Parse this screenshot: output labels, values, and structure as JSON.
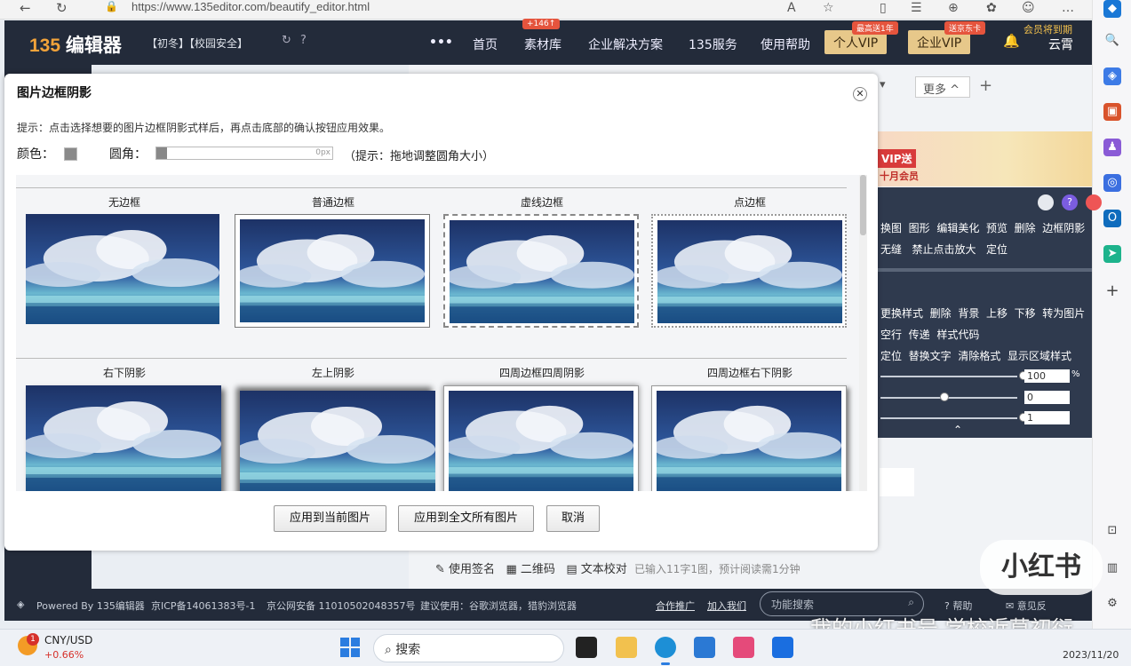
{
  "browser": {
    "url": "https://www.135editor.com/beautify_editor.html"
  },
  "header": {
    "logo_num": "135",
    "logo_text": "编辑器",
    "tags": "【初冬】【校园安全】",
    "nav": [
      "首页",
      "素材库",
      "企业解决方案",
      "135服务",
      "使用帮助"
    ],
    "nav_badge": "+146↑",
    "vip_personal": "个人VIP",
    "vip_personal_badge": "最高送1年",
    "vip_enterprise": "企业VIP",
    "vip_enterprise_badge": "送京东卡",
    "member_note": "会员将到期",
    "user": "云霄"
  },
  "editor_side": {
    "more_tab": "更多 ^",
    "banner_vip": "VIP送",
    "banner_vip2": "十月会员",
    "panel_row1": [
      "换图",
      "图形",
      "编辑美化",
      "预览",
      "删除",
      "边框阴影"
    ],
    "panel_row2": [
      "无缝",
      "禁止点击放大",
      "定位"
    ],
    "panel_row3": [
      "更换样式",
      "删除",
      "背景",
      "上移",
      "下移",
      "转为图片"
    ],
    "panel_row4": [
      "空行",
      "传递",
      "样式代码"
    ],
    "panel_row5": [
      "定位",
      "替换文字",
      "清除格式",
      "显示区域样式"
    ],
    "slider_values": [
      "100",
      "0",
      "1"
    ],
    "percent": "%"
  },
  "toolbar_bottom": {
    "signature": "使用签名",
    "qrcode": "二维码",
    "proofread": "文本校对",
    "hint": "已输入11字1图，预计阅读需1分钟"
  },
  "footer": {
    "powered": "Powered By 135编辑器",
    "icp": "京ICP备14061383号-1",
    "security": "京公网安备 11010502048357号",
    "browser_tip": "建议使用：谷歌浏览器，猎豹浏览器",
    "partner": "合作推广",
    "join": "加入我们",
    "search_placeholder": "功能搜索",
    "help": "帮助",
    "feedback": "意见反"
  },
  "modal": {
    "title": "图片边框阴影",
    "tip": "提示：点击选择想要的图片边框阴影式样后，再点击底部的确认按钮应用效果。",
    "color_label": "颜色：",
    "color_value": "#8a8a8a",
    "radius_label": "圆角：",
    "radius_value": "0px",
    "radius_tip": "（提示：拖地调整圆角大小）",
    "styles_row1": [
      "无边框",
      "普通边框",
      "虚线边框",
      "点边框"
    ],
    "styles_row2": [
      "右下阴影",
      "左上阴影",
      "四周边框四周阴影",
      "四周边框右下阴影"
    ],
    "btn_apply_current": "应用到当前图片",
    "btn_apply_all": "应用到全文所有图片",
    "btn_cancel": "取消"
  },
  "taskbar": {
    "stock_name": "CNY/USD",
    "stock_change": "+0.66%",
    "stock_badge": "1",
    "search": "搜索",
    "date": "2023/11/20"
  },
  "watermark": {
    "logo": "小红书",
    "text": "我的小红书号 学校近草初衍"
  }
}
